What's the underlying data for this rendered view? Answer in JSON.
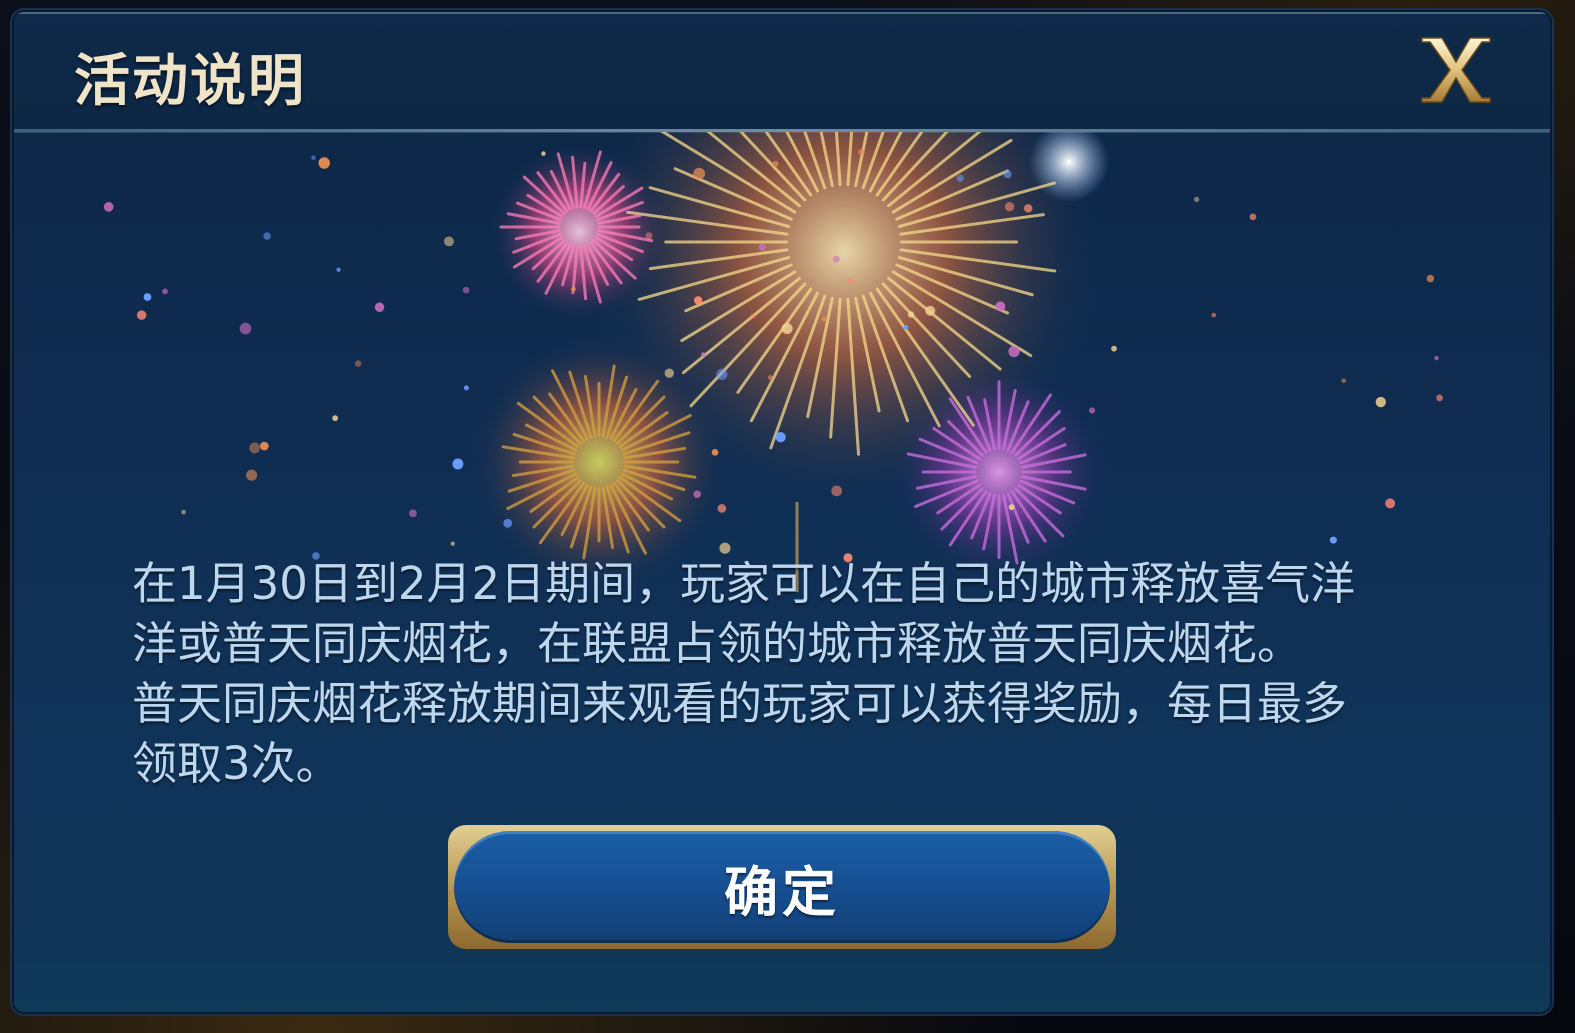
{
  "dialog": {
    "title": "活动说明",
    "close_label": "X",
    "body_lines": [
      "在1月30日到2月2日期间，玩家可以在自己的城市释放喜气洋",
      "洋或普天同庆烟花，在联盟占领的城市释放普天同庆烟花。",
      "普天同庆烟花释放期间来观看的玩家可以获得奖励，每日最多",
      "领取3次。"
    ],
    "confirm_label": "确定"
  },
  "colors": {
    "title": "#f0e4c8",
    "body_text": "#bcd7ee",
    "button_fill": "#164f91",
    "button_border": "#c9aa62",
    "panel_bg": "#0f2d52"
  },
  "icons": {
    "close": "close-x-icon",
    "artwork": "fireworks-illustration"
  }
}
